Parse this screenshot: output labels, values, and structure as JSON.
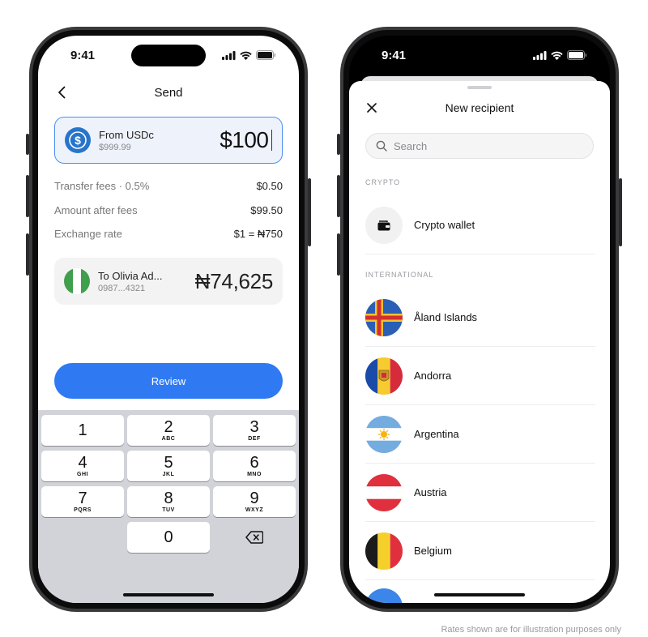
{
  "status_time": "9:41",
  "send": {
    "title": "Send",
    "from": {
      "label": "From USDc",
      "balance": "$999.99",
      "amount": "$100"
    },
    "fees": [
      {
        "label": "Transfer fees · 0.5%",
        "value": "$0.50"
      },
      {
        "label": "Amount after fees",
        "value": "$99.50"
      },
      {
        "label": "Exchange rate",
        "value": "$1 = ₦750"
      }
    ],
    "to": {
      "label": "To Olivia Ad...",
      "account": "0987...4321",
      "amount": "₦74,625"
    },
    "review_label": "Review",
    "keys": [
      [
        {
          "num": "1",
          "let": ""
        },
        {
          "num": "2",
          "let": "ABC"
        },
        {
          "num": "3",
          "let": "DEF"
        }
      ],
      [
        {
          "num": "4",
          "let": "GHI"
        },
        {
          "num": "5",
          "let": "JKL"
        },
        {
          "num": "6",
          "let": "MNO"
        }
      ],
      [
        {
          "num": "7",
          "let": "PQRS"
        },
        {
          "num": "8",
          "let": "TUV"
        },
        {
          "num": "9",
          "let": "WXYZ"
        }
      ],
      [
        {
          "num": "",
          "let": ""
        },
        {
          "num": "0",
          "let": ""
        },
        {
          "num": "",
          "let": ""
        }
      ]
    ]
  },
  "recipient": {
    "title": "New recipient",
    "search_placeholder": "Search",
    "crypto_section": "CRYPTO",
    "crypto_wallet": "Crypto wallet",
    "international_section": "INTERNATIONAL",
    "countries": [
      "Åland Islands",
      "Andorra",
      "Argentina",
      "Austria",
      "Belgium"
    ]
  },
  "footnote": "Rates shown are for illustration purposes only",
  "colors": {
    "accent": "#2f7af3",
    "usdc": "#2775ca",
    "nigeria_green": "#3f9f4c"
  }
}
